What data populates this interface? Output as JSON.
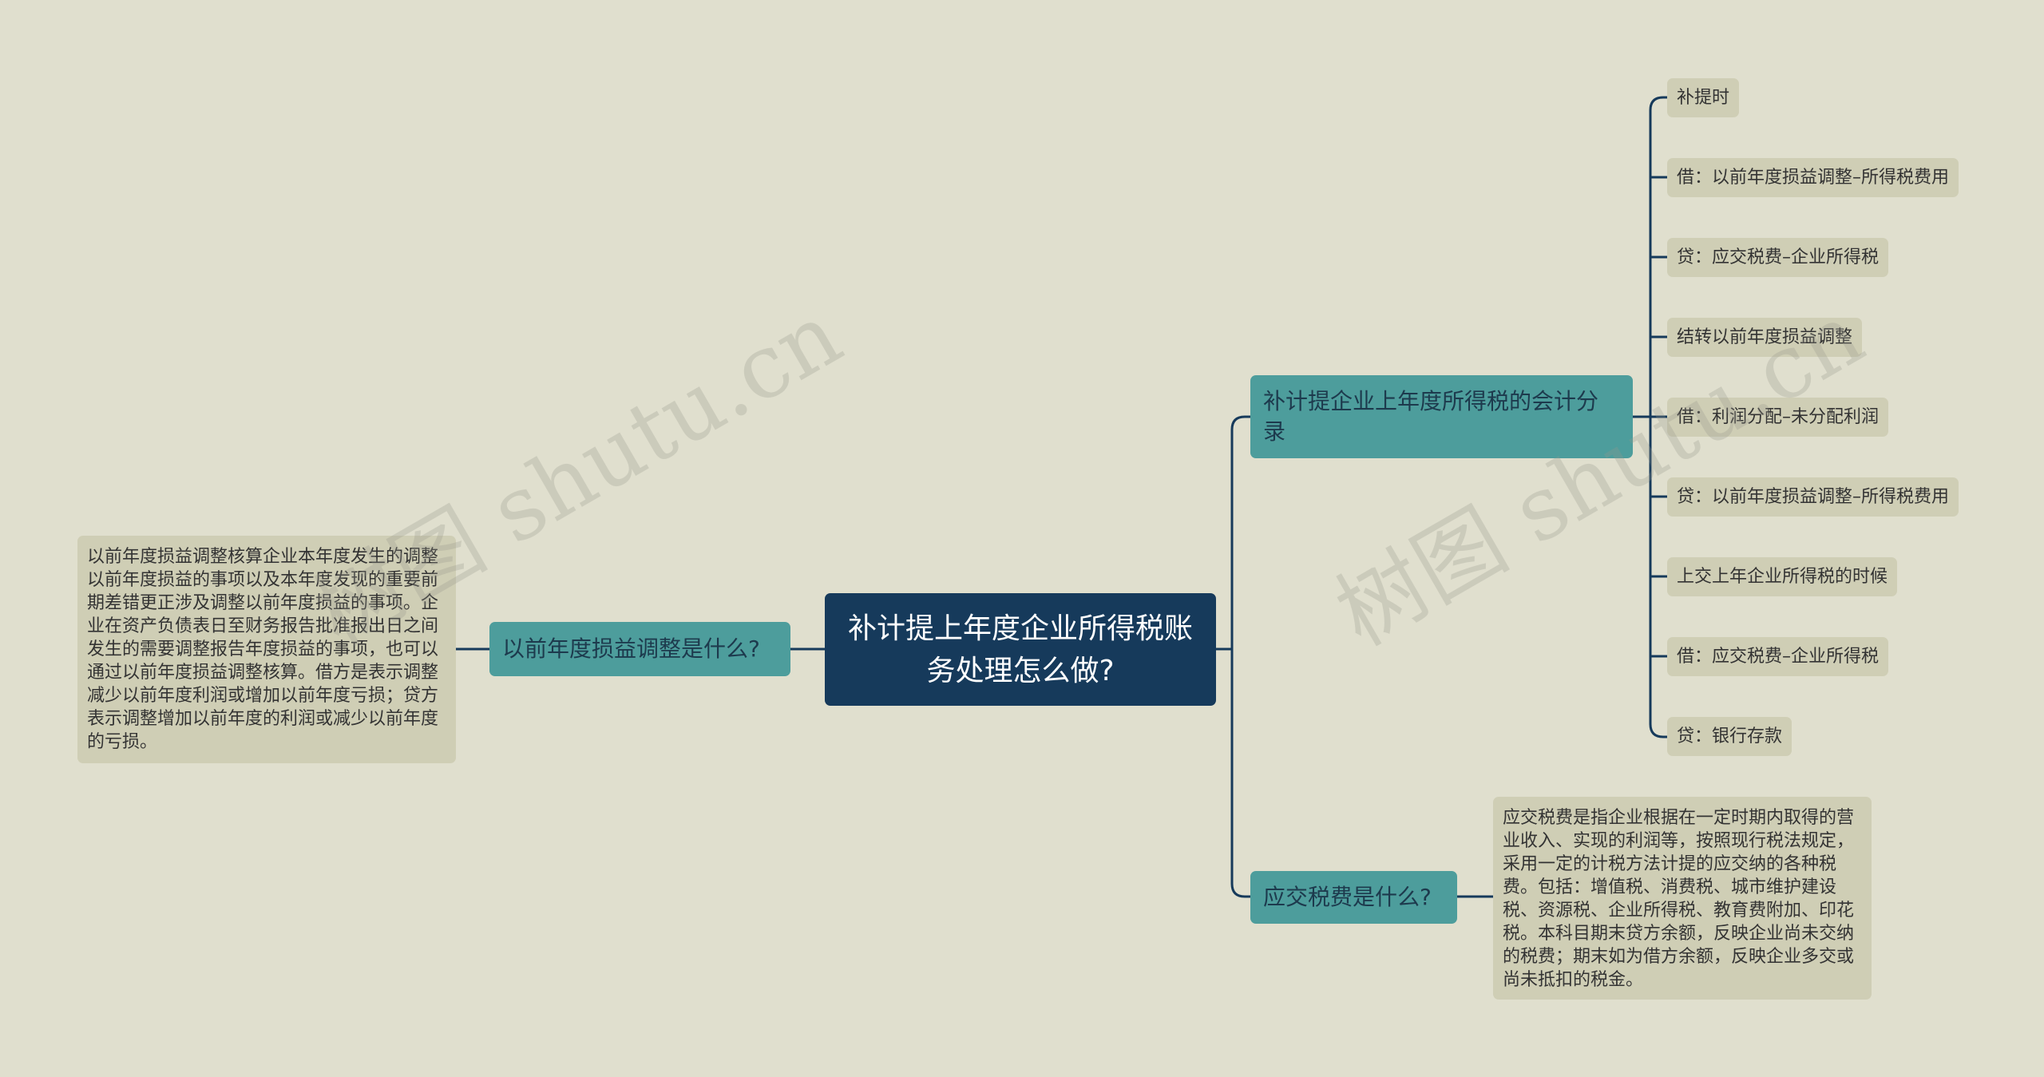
{
  "root": {
    "title": "补计提上年度企业所得税账务处理怎么做?"
  },
  "left_branch": {
    "label": "以前年度损益调整是什么?",
    "detail": "以前年度损益调整核算企业本年度发生的调整以前年度损益的事项以及本年度发现的重要前期差错更正涉及调整以前年度损益的事项。企业在资产负债表日至财务报告批准报出日之间发生的需要调整报告年度损益的事项，也可以通过以前年度损益调整核算。借方是表示调整减少以前年度利润或增加以前年度亏损；贷方表示调整增加以前年度的利润或减少以前年度的亏损。"
  },
  "right_branch_1": {
    "label": "补计提企业上年度所得税的会计分录",
    "items": [
      "补提时",
      "借：以前年度损益调整–所得税费用",
      "贷：应交税费–企业所得税",
      "结转以前年度损益调整",
      "借：利润分配–未分配利润",
      "贷：以前年度损益调整–所得税费用",
      "上交上年企业所得税的时候",
      "借：应交税费–企业所得税",
      "贷：银行存款"
    ]
  },
  "right_branch_2": {
    "label": "应交税费是什么?",
    "detail": "应交税费是指企业根据在一定时期内取得的营业收入、实现的利润等，按照现行税法规定，采用一定的计税方法计提的应交纳的各种税费。包括：增值税、消费税、城市维护建设税、资源税、企业所得税、教育费附加、印花税。本科目期末贷方余额，反映企业尚未交纳的税费；期末如为借方余额，反映企业多交或尚未抵扣的税金。"
  },
  "watermark": "树图 shutu.cn",
  "colors": {
    "background": "#e0dfce",
    "root_fill": "#163a5b",
    "branch_fill": "#4d9d9c",
    "leaf_fill": "#cfceb5",
    "connector": "#163a5b"
  }
}
